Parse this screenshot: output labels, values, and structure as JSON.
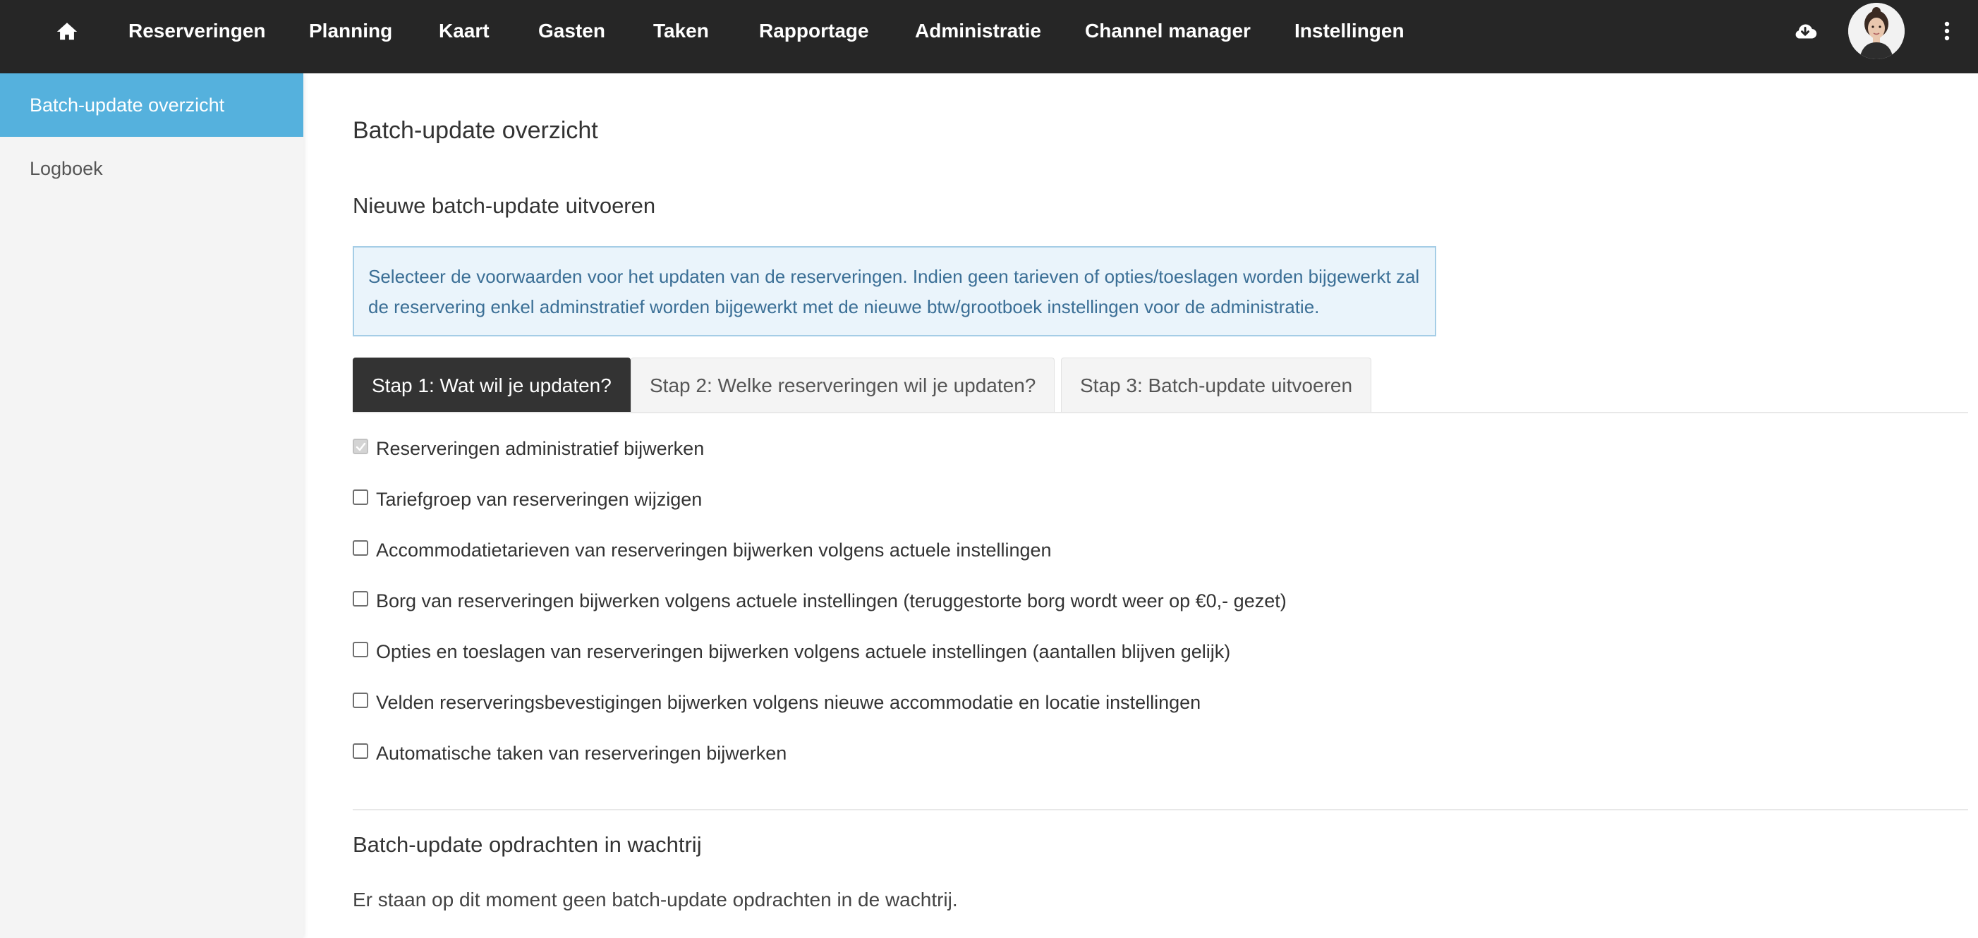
{
  "topnav": {
    "home_icon": "home-icon",
    "items": [
      {
        "label": "Reserveringen"
      },
      {
        "label": "Planning"
      },
      {
        "label": "Kaart"
      },
      {
        "label": "Gasten"
      },
      {
        "label": "Taken"
      },
      {
        "label": "Rapportage"
      },
      {
        "label": "Administratie"
      },
      {
        "label": "Channel manager"
      },
      {
        "label": "Instellingen"
      }
    ],
    "right_icons": [
      "cloud-download-icon",
      "avatar",
      "more-vertical-icon"
    ]
  },
  "sidebar": {
    "items": [
      {
        "label": "Batch-update overzicht",
        "active": true
      },
      {
        "label": "Logboek",
        "active": false
      }
    ]
  },
  "main": {
    "title": "Batch-update overzicht",
    "new_section_title": "Nieuwe batch-update uitvoeren",
    "info_text": "Selecteer de voorwaarden voor het updaten van de reserveringen. Indien geen tarieven of opties/toeslagen worden bijgewerkt zal de reservering enkel adminstratief worden bijgewerkt met de nieuwe btw/grootboek instellingen voor de administratie.",
    "tabs": [
      {
        "label": "Stap 1: Wat wil je updaten?",
        "active": true
      },
      {
        "label": "Stap 2: Welke reserveringen wil je updaten?",
        "active": false
      },
      {
        "label": "Stap 3: Batch-update uitvoeren",
        "active": false
      }
    ],
    "options": [
      {
        "label": "Reserveringen administratief bijwerken",
        "checked": true,
        "disabled": true
      },
      {
        "label": "Tariefgroep van reserveringen wijzigen",
        "checked": false
      },
      {
        "label": "Accommodatietarieven van reserveringen bijwerken volgens actuele instellingen",
        "checked": false
      },
      {
        "label": "Borg van reserveringen bijwerken volgens actuele instellingen (teruggestorte borg wordt weer op €0,- gezet)",
        "checked": false
      },
      {
        "label": "Opties en toeslagen van reserveringen bijwerken volgens actuele instellingen (aantallen blijven gelijk)",
        "checked": false
      },
      {
        "label": "Velden reserveringsbevestigingen bijwerken volgens nieuwe accommodatie en locatie instellingen",
        "checked": false
      },
      {
        "label": "Automatische taken van reserveringen bijwerken",
        "checked": false
      }
    ],
    "queue_title": "Batch-update opdrachten in wachtrij",
    "queue_empty_text": "Er staan op dit moment geen batch-update opdrachten in de wachtrij."
  },
  "colors": {
    "topbar": "#262626",
    "sidebar_active": "#55b1dd",
    "info_bg": "#eaf4fb",
    "info_border": "#a5cde6",
    "info_text": "#3b6f96",
    "tab_active": "#333333"
  }
}
